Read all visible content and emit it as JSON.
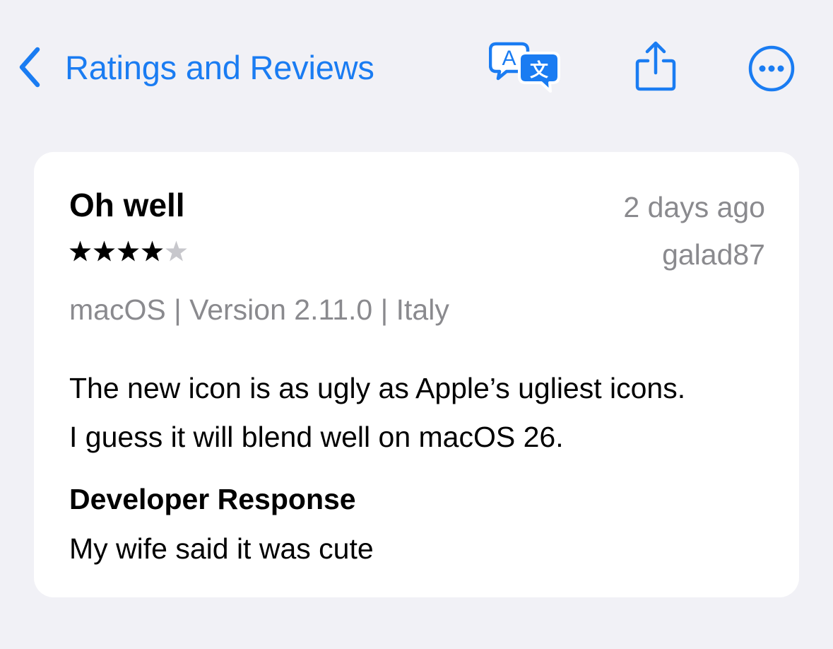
{
  "nav": {
    "back_label": "Ratings and Reviews",
    "icons": [
      "chevron-left-icon",
      "translate-icon",
      "share-icon",
      "more-icon"
    ],
    "accent_color": "#1a7cf2"
  },
  "review": {
    "title": "Oh well",
    "date": "2 days ago",
    "author": "galad87",
    "rating": 4,
    "rating_max": 5,
    "meta": "macOS | Version 2.11.0 | Italy",
    "body_lines": [
      "The new icon is as ugly as Apple’s ugliest icons.",
      "I guess it will blend well on macOS 26."
    ],
    "developer_response": {
      "heading": "Developer Response",
      "text": "My wife said it was cute"
    }
  },
  "colors": {
    "background": "#f1f1f6",
    "card": "#ffffff",
    "secondary_text": "#8a8a8e",
    "star_filled": "#000000",
    "star_empty": "#c7c7cc"
  }
}
